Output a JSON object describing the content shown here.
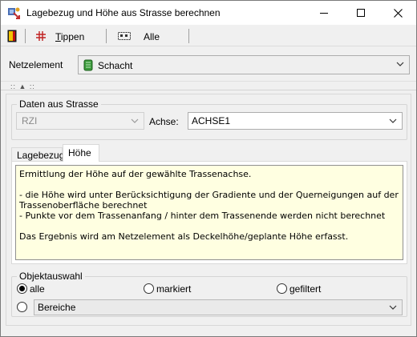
{
  "window": {
    "title": "Lagebezug und Höhe aus Strasse berechnen"
  },
  "toolbar": {
    "tippen_prefix": "T",
    "tippen_rest": "ippen",
    "alle_label": "Alle"
  },
  "netzelement": {
    "label": "Netzelement",
    "value": "Schacht"
  },
  "strasse": {
    "group_label": "Daten aus Strasse",
    "rzi_value": "RZI",
    "achse_label": "Achse:",
    "achse_value": "ACHSE1"
  },
  "tabs": [
    {
      "label": "Lagebezug",
      "active": false
    },
    {
      "label": "Höhe",
      "active": true
    }
  ],
  "info": {
    "line1": "Ermittlung der Höhe auf der gewählte Trassenachse.",
    "line2": "- die Höhe wird unter Berücksichtigung der Gradiente und der Querneigungen auf der Trassenoberfläche berechnet",
    "line3": "- Punkte vor dem Trassenanfang / hinter dem Trassenende werden nicht berechnet",
    "line4": "Das Ergebnis wird am Netzelement als Deckelhöhe/geplante Höhe erfasst."
  },
  "objektauswahl": {
    "group_label": "Objektauswahl",
    "options": [
      {
        "label": "alle",
        "checked": true
      },
      {
        "label": "markiert",
        "checked": false
      },
      {
        "label": "gefiltert",
        "checked": false
      },
      {
        "label": "",
        "checked": false
      }
    ],
    "bereiche_value": "Bereiche"
  },
  "colors": {
    "info_background": "#ffffe1",
    "window_background": "#f0f0f0",
    "netz_icon": "#3a9a3a"
  }
}
